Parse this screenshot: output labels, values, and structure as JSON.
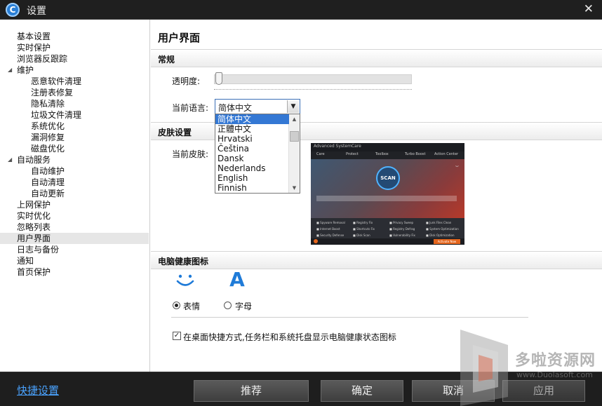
{
  "window": {
    "title": "设置",
    "logo_letter": "C"
  },
  "sidebar": {
    "items": [
      {
        "label": "基本设置",
        "level": 0
      },
      {
        "label": "实时保护",
        "level": 0
      },
      {
        "label": "浏览器反跟踪",
        "level": 0
      },
      {
        "label": "维护",
        "level": 0,
        "expanded": true
      },
      {
        "label": "恶意软件清理",
        "level": 1
      },
      {
        "label": "注册表修复",
        "level": 1
      },
      {
        "label": "隐私清除",
        "level": 1
      },
      {
        "label": "垃圾文件清理",
        "level": 1
      },
      {
        "label": "系统优化",
        "level": 1
      },
      {
        "label": "漏洞修复",
        "level": 1
      },
      {
        "label": "磁盘优化",
        "level": 1
      },
      {
        "label": "自动服务",
        "level": 0,
        "expanded": true
      },
      {
        "label": "自动维护",
        "level": 1
      },
      {
        "label": "自动清理",
        "level": 1
      },
      {
        "label": "自动更新",
        "level": 1
      },
      {
        "label": "上网保护",
        "level": 0
      },
      {
        "label": "实时优化",
        "level": 0
      },
      {
        "label": "忽略列表",
        "level": 0
      },
      {
        "label": "用户界面",
        "level": 0,
        "active": true
      },
      {
        "label": "日志与备份",
        "level": 0
      },
      {
        "label": "通知",
        "level": 0
      },
      {
        "label": "首页保护",
        "level": 0
      }
    ]
  },
  "main": {
    "title": "用户界面",
    "general": {
      "section_title": "常规",
      "transparency_label": "透明度:",
      "transparency_value": 0.0,
      "language_label": "当前语言:",
      "language_value": "简体中文",
      "language_options": [
        "简体中文",
        "正體中文",
        "Hrvatski",
        "Čeština",
        "Dansk",
        "Nederlands",
        "English",
        "Finnish"
      ]
    },
    "skin": {
      "section_title": "皮肤设置",
      "current_skin_label": "当前皮肤:",
      "preview": {
        "app_name": "Advanced SystemCare",
        "tabs": [
          "Care",
          "Protect",
          "Toolbox",
          "Turbo Boost",
          "Action Center"
        ],
        "scan_label": "SCAN",
        "items": [
          "Spyware Removal",
          "Registry Fix",
          "Privacy Sweep",
          "Junk Files Clean",
          "Internet Boost",
          "Shortcuts Fix",
          "Registry Defrag",
          "System Optimization",
          "Security Defense",
          "Disk Scan",
          "Vulnerability Fix",
          "Disk Optimization"
        ],
        "activate_label": "Activate Now"
      }
    },
    "health_icon": {
      "section_title": "电脑健康图标",
      "option_emoji": "表情",
      "option_letter": "字母",
      "letter_icon": "A",
      "selected": "emoji",
      "tray_checkbox_label": "在桌面快捷方式,任务栏和系统托盘显示电脑健康状态图标",
      "tray_checkbox_checked": true
    }
  },
  "footer": {
    "quick_settings": "快捷设置",
    "recommend": "推荐",
    "ok": "确定",
    "cancel": "取消",
    "apply": "应用"
  },
  "watermark": {
    "text": "多啦资源网",
    "url": "www.Duolasoft.com"
  },
  "colors": {
    "accent": "#3478d4",
    "link": "#4aa3ff",
    "icon_blue": "#1f7bd8",
    "titlebar": "#1f1f1f"
  },
  "icons": [
    "close-icon",
    "app-logo-icon",
    "smile-icon",
    "letter-a-icon",
    "chevron-down-icon",
    "chevron-up-icon"
  ]
}
